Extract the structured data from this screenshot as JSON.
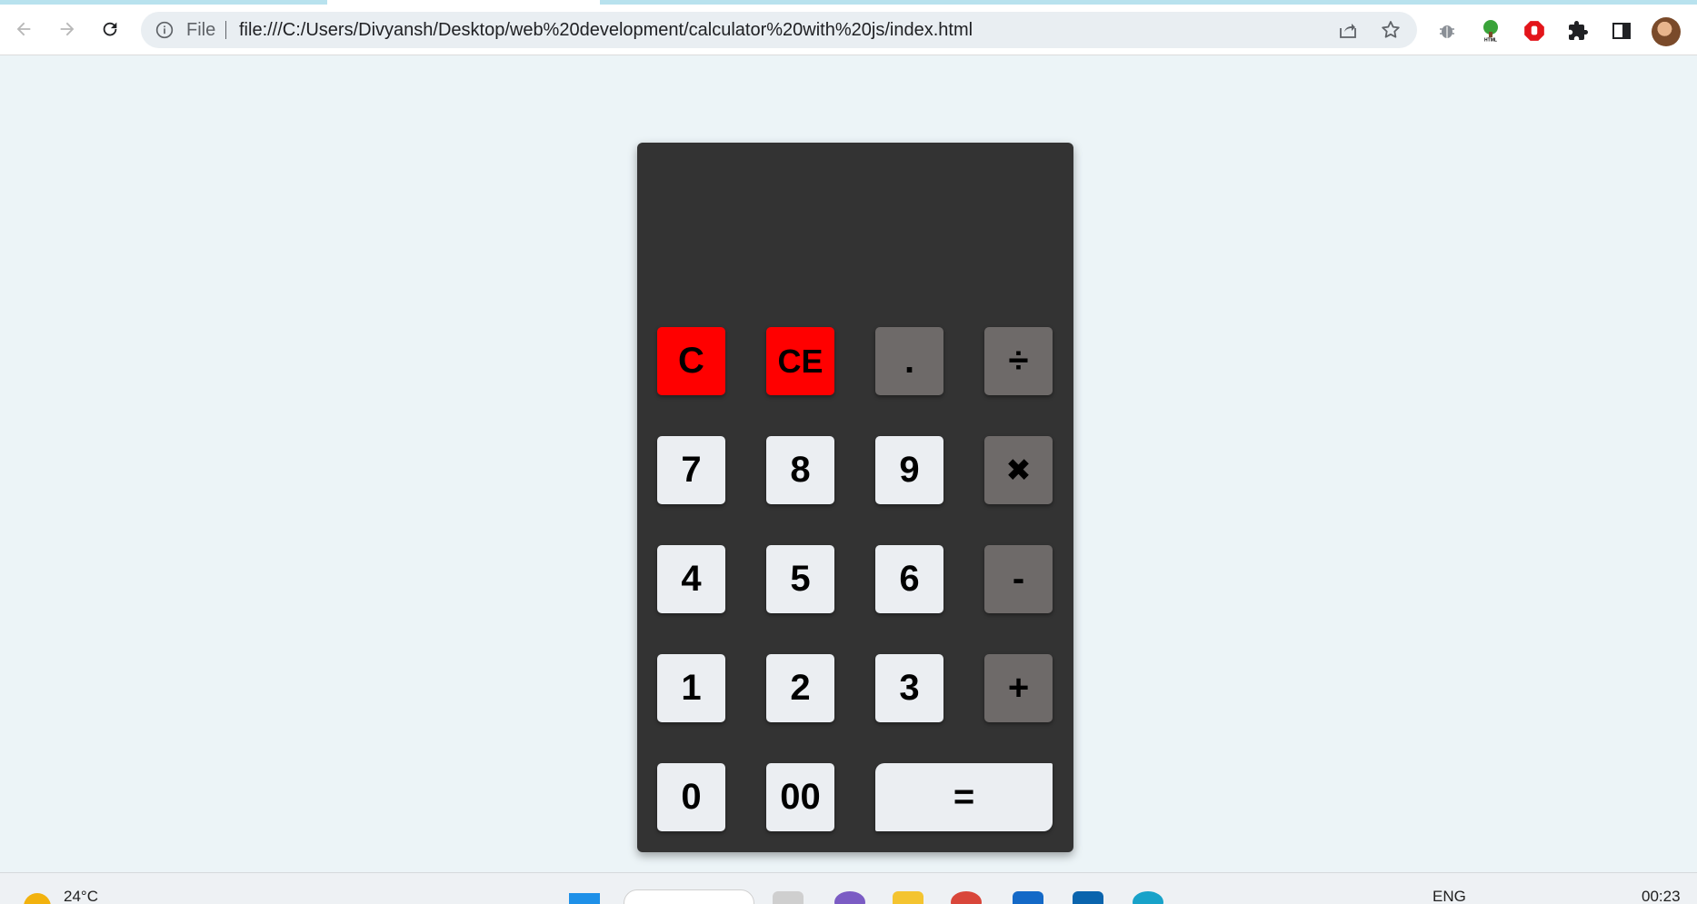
{
  "browser": {
    "address_scheme": "File",
    "address_url": "file:///C:/Users/Divyansh/Desktop/web%20development/calculator%20with%20js/index.html",
    "icons": {
      "back": "back-arrow-icon",
      "forward": "forward-arrow-icon",
      "reload": "reload-icon",
      "info": "info-icon",
      "share": "share-icon",
      "bookmark": "star-icon",
      "extensions": [
        "bug-extension-icon",
        "html-tree-extension-icon",
        "stop-hand-extension-icon",
        "puzzle-icon",
        "side-panel-icon"
      ],
      "profile": "profile-avatar"
    }
  },
  "calculator": {
    "display_value": "",
    "keys": [
      {
        "label": "C",
        "kind": "clear"
      },
      {
        "label": "CE",
        "kind": "clear"
      },
      {
        "label": ".",
        "kind": "operator"
      },
      {
        "label": "÷",
        "kind": "operator"
      },
      {
        "label": "7",
        "kind": "digit"
      },
      {
        "label": "8",
        "kind": "digit"
      },
      {
        "label": "9",
        "kind": "digit"
      },
      {
        "label": "✖",
        "kind": "operator"
      },
      {
        "label": "4",
        "kind": "digit"
      },
      {
        "label": "5",
        "kind": "digit"
      },
      {
        "label": "6",
        "kind": "digit"
      },
      {
        "label": "-",
        "kind": "operator"
      },
      {
        "label": "1",
        "kind": "digit"
      },
      {
        "label": "2",
        "kind": "digit"
      },
      {
        "label": "3",
        "kind": "digit"
      },
      {
        "label": "+",
        "kind": "operator"
      },
      {
        "label": "0",
        "kind": "digit"
      },
      {
        "label": "00",
        "kind": "digit"
      },
      {
        "label": "=",
        "kind": "equals"
      }
    ],
    "colors": {
      "body": "#333333",
      "clear_key": "#ff0000",
      "operator_key": "#6e6a69",
      "digit_key": "#ebeef2",
      "page_background": "#ecf4f7"
    }
  },
  "taskbar": {
    "temperature": "24°C",
    "language": "ENG",
    "time": "00:23"
  }
}
